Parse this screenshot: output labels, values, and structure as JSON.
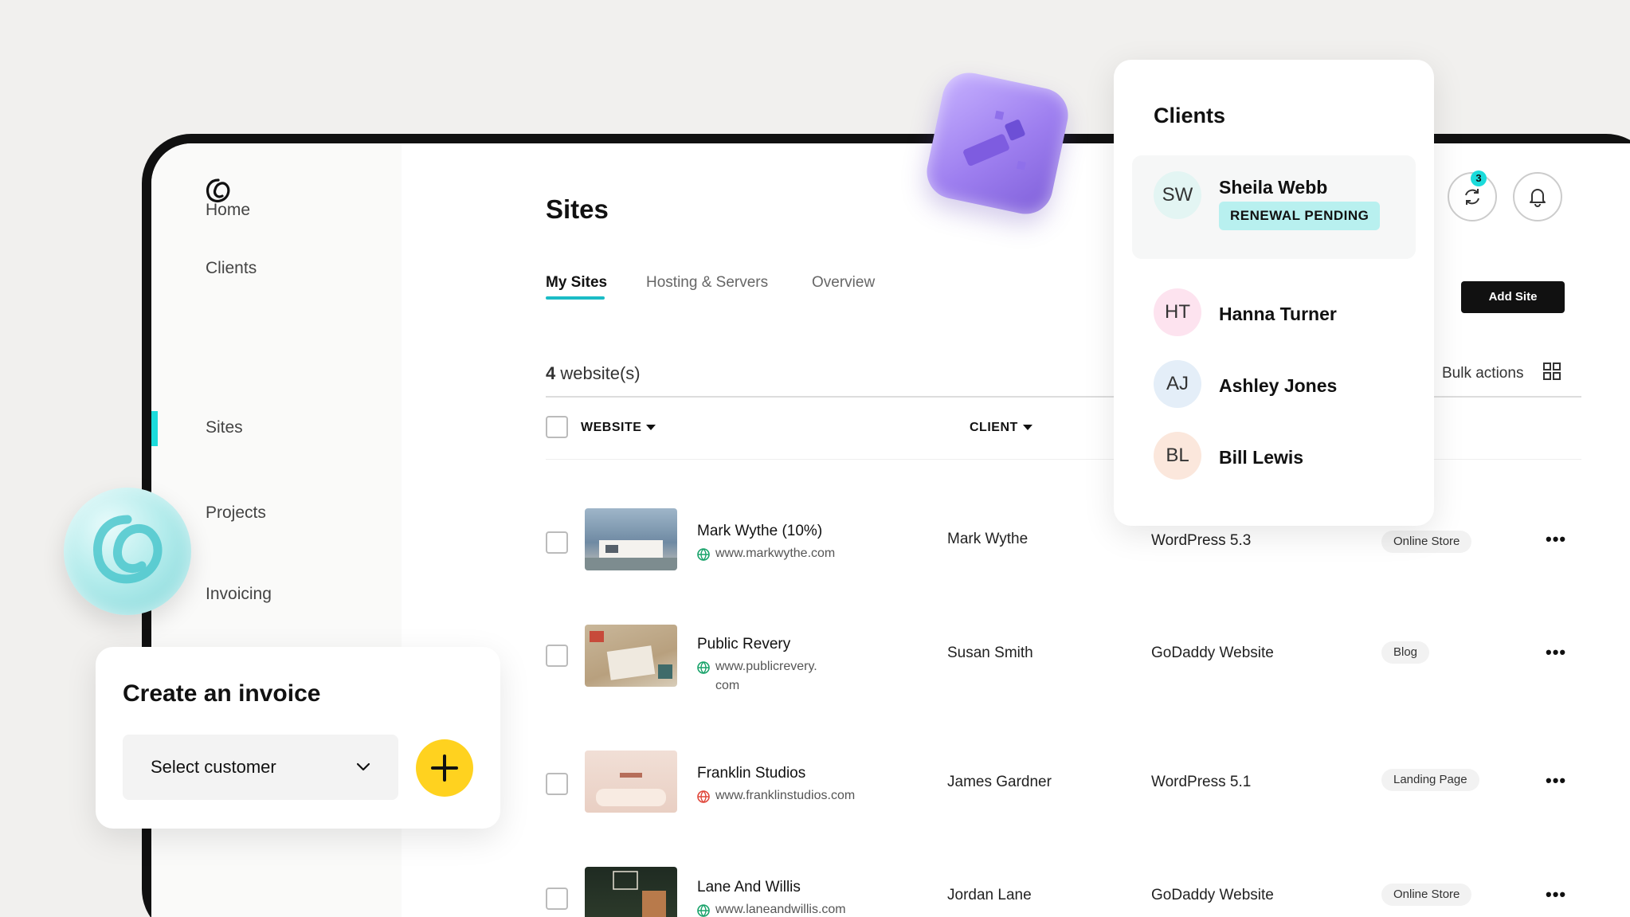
{
  "sidebar": {
    "items": [
      {
        "label": "Home"
      },
      {
        "label": "Clients"
      },
      {
        "label": "Sites"
      },
      {
        "label": "Projects"
      },
      {
        "label": "Invoicing"
      }
    ],
    "active": "Sites"
  },
  "page": {
    "title": "Sites",
    "tabs": [
      {
        "label": "My Sites",
        "active": true
      },
      {
        "label": "Hosting & Servers",
        "active": false
      },
      {
        "label": "Overview",
        "active": false
      }
    ],
    "count_number": "4",
    "count_label": " website(s)",
    "bulk_actions": "Bulk actions",
    "add_site": "Add Site",
    "notification_count": "3"
  },
  "table": {
    "columns": {
      "website": "WEBSITE",
      "client": "CLIENT"
    },
    "rows": [
      {
        "name": "Mark Wythe (10%)",
        "url": "www.markwythe.com",
        "client": "Mark Wythe",
        "platform": "WordPress 5.3",
        "tag": "Online Store",
        "status_color": "#1aa36b"
      },
      {
        "name": "Public Revery",
        "url": "www.publicrevery.\ncom",
        "client": "Susan Smith",
        "platform": "GoDaddy Website",
        "tag": "Blog",
        "status_color": "#1aa36b"
      },
      {
        "name": "Franklin Studios",
        "url": "www.franklinstudios.com",
        "client": "James Gardner",
        "platform": "WordPress 5.1",
        "tag": "Landing Page",
        "status_color": "#e0483c"
      },
      {
        "name": "Lane And Willis",
        "url": "www.laneandwillis.com",
        "client": "Jordan Lane",
        "platform": "GoDaddy Website",
        "tag": "Online Store",
        "status_color": "#1aa36b"
      }
    ]
  },
  "clients_popover": {
    "title": "Clients",
    "clients": [
      {
        "initials": "SW",
        "name": "Sheila Webb",
        "status": "RENEWAL PENDING",
        "avatar_color": "#e3f5f3"
      },
      {
        "initials": "HT",
        "name": "Hanna Turner",
        "avatar_color": "#fde3ef"
      },
      {
        "initials": "AJ",
        "name": "Ashley Jones",
        "avatar_color": "#e4eef8"
      },
      {
        "initials": "BL",
        "name": "Bill Lewis",
        "avatar_color": "#fbe7dc"
      }
    ]
  },
  "invoice_card": {
    "title": "Create an invoice",
    "select_placeholder": "Select customer"
  },
  "colors": {
    "accent_teal": "#1bdbdb",
    "plus_yellow": "#ffd21f",
    "add_button": "#111111"
  }
}
